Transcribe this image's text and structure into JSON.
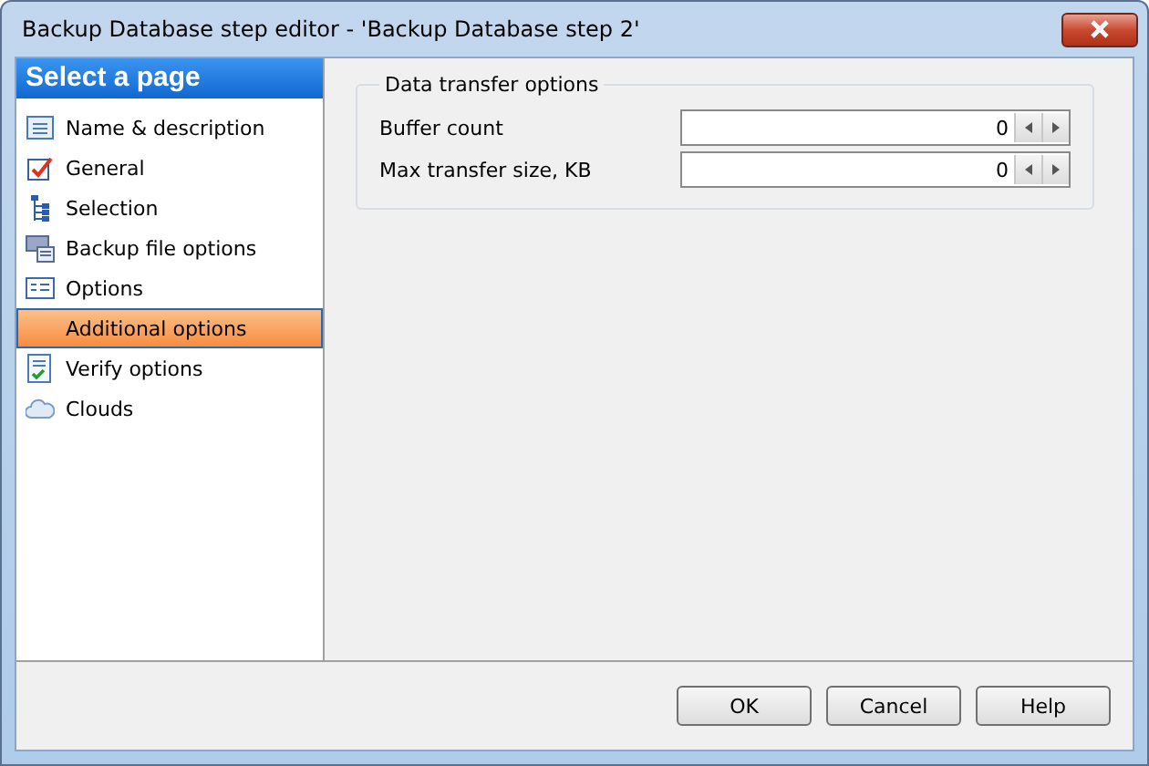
{
  "window": {
    "title": "Backup Database step editor - 'Backup Database step 2'"
  },
  "sidebar": {
    "header": "Select a page",
    "items": [
      {
        "label": "Name & description",
        "selected": false
      },
      {
        "label": "General",
        "selected": false
      },
      {
        "label": "Selection",
        "selected": false
      },
      {
        "label": "Backup file options",
        "selected": false
      },
      {
        "label": "Options",
        "selected": false
      },
      {
        "label": "Additional options",
        "selected": true
      },
      {
        "label": "Verify options",
        "selected": false
      },
      {
        "label": "Clouds",
        "selected": false
      }
    ]
  },
  "group": {
    "title": "Data transfer options",
    "fields": [
      {
        "label": "Buffer count",
        "value": "0"
      },
      {
        "label": "Max transfer size, KB",
        "value": "0"
      }
    ]
  },
  "buttons": [
    "OK",
    "Cancel",
    "Help"
  ]
}
